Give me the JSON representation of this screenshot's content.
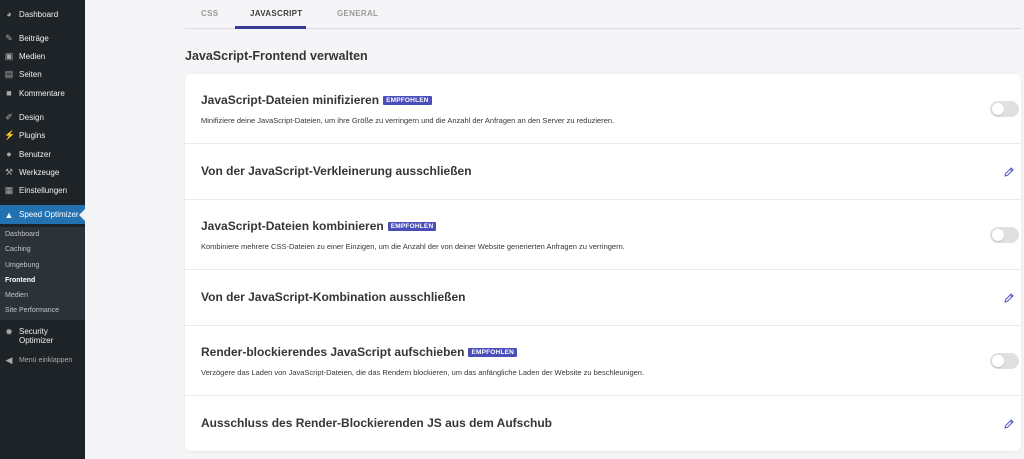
{
  "sidebar": {
    "items": [
      {
        "label": "Dashboard",
        "icon": "dashboard-icon"
      },
      {
        "label": "Beiträge",
        "icon": "pin-icon"
      },
      {
        "label": "Medien",
        "icon": "media-icon"
      },
      {
        "label": "Seiten",
        "icon": "pages-icon"
      },
      {
        "label": "Kommentare",
        "icon": "comment-icon"
      },
      {
        "label": "Design",
        "icon": "brush-icon"
      },
      {
        "label": "Plugins",
        "icon": "plugin-icon"
      },
      {
        "label": "Benutzer",
        "icon": "user-icon"
      },
      {
        "label": "Werkzeuge",
        "icon": "wrench-icon"
      },
      {
        "label": "Einstellungen",
        "icon": "settings-icon"
      },
      {
        "label": "Speed Optimizer",
        "icon": "speed-optimizer-icon"
      }
    ],
    "submenu": [
      "Dashboard",
      "Caching",
      "Umgebung",
      "Frontend",
      "Medien",
      "Site Performance"
    ],
    "security": {
      "line1": "Security",
      "line2": "Optimizer"
    },
    "collapse": "Menü einklappen"
  },
  "tabs": [
    "CSS",
    "JAVASCRIPT",
    "GENERAL"
  ],
  "section_title": "JavaScript-Frontend verwalten",
  "badge_label": "EMPFOHLEN",
  "rows": [
    {
      "title": "JavaScript-Dateien minifizieren",
      "desc": "Minifiziere deine JavaScript-Dateien, um ihre Größe zu verringern und die Anzahl der Anfragen an den Server zu reduzieren.",
      "enabled": false
    },
    {
      "title": "Von der JavaScript-Verkleinerung ausschließen"
    },
    {
      "title": "JavaScript-Dateien kombinieren",
      "desc": "Kombiniere mehrere CSS-Dateien zu einer Einzigen, um die Anzahl der von deiner Website generierten Anfragen zu verringern.",
      "enabled": false
    },
    {
      "title": "Von der JavaScript-Kombination ausschließen"
    },
    {
      "title": "Render-blockierendes JavaScript aufschieben",
      "desc": "Verzögere das Laden von JavaScript-Dateien, die das Rendern blockieren, um das anfängliche Laden der Website zu beschleunigen.",
      "enabled": false
    },
    {
      "title": "Ausschluss des Render-Blockierenden JS aus dem Aufschub"
    }
  ],
  "colors": {
    "accent": "#4a4eb9",
    "sidebar": "#1d2327",
    "active_menu": "#2271b1",
    "tab_underline": "#363b95",
    "edit_icon": "#5b5fc7"
  }
}
